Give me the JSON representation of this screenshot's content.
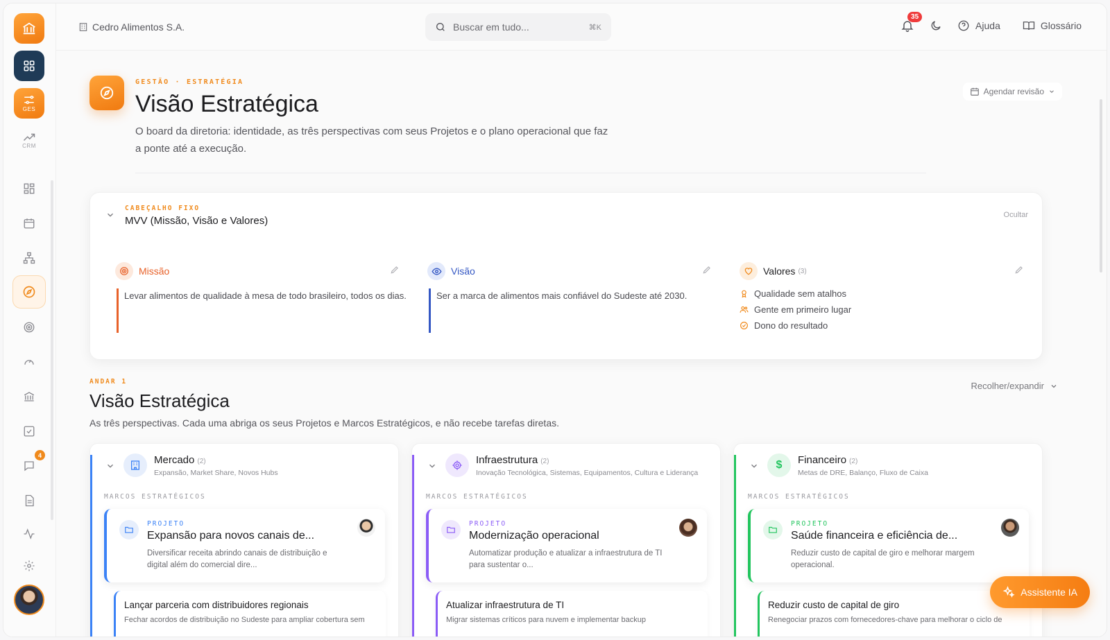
{
  "topbar": {
    "company": "Cedro Alimentos S.A.",
    "search_placeholder": "Buscar em tudo...",
    "search_shortcut": "⌘K",
    "notifications_count": "35",
    "help_label": "Ajuda",
    "glossary_label": "Glossário"
  },
  "sidebar": {
    "ges_label": "GES",
    "crm_label": "CRM",
    "messages_badge": "4"
  },
  "page": {
    "breadcrumb": "GESTÃO · ESTRATÉGIA",
    "title": "Visão Estratégica",
    "description": "O board da diretoria: identidade, as três perspectivas com seus Projetos e o plano operacional que faz a ponte até a execução.",
    "schedule_label": "Agendar revisão"
  },
  "mvv": {
    "label": "CABEÇALHO FIXO",
    "title": "MVV (Missão, Visão e Valores)",
    "hide_label": "Ocultar",
    "missao": {
      "title": "Missão",
      "text": "Levar alimentos de qualidade à mesa de todo brasileiro, todos os dias."
    },
    "visao": {
      "title": "Visão",
      "text": "Ser a marca de alimentos mais confiável do Sudeste até 2030."
    },
    "valores": {
      "title": "Valores",
      "count": "(3)",
      "items": [
        "Qualidade sem atalhos",
        "Gente em primeiro lugar",
        "Dono do resultado"
      ]
    }
  },
  "section": {
    "label": "ANDAR 1",
    "title": "Visão Estratégica",
    "description": "As três perspectivas. Cada uma abriga os seus Projetos e Marcos Estratégicos, e não recebe tarefas diretas.",
    "collapse_label": "Recolher/expandir"
  },
  "perspectives": [
    {
      "title": "Mercado",
      "count": "(2)",
      "subtitle": "Expansão, Market Share, Novos Hubs",
      "marcos_label": "MARCOS ESTRATÉGICOS",
      "project_label": "PROJETO",
      "project_title": "Expansão para novos canais de...",
      "project_desc": "Diversificar receita abrindo canais de distribuição e digital além do comercial dire...",
      "marco_title": "Lançar parceria com distribuidores regionais",
      "marco_desc": "Fechar acordos de distribuição no Sudeste para ampliar cobertura sem"
    },
    {
      "title": "Infraestrutura",
      "count": "(2)",
      "subtitle": "Inovação Tecnológica, Sistemas, Equipamentos, Cultura e Liderança",
      "marcos_label": "MARCOS ESTRATÉGICOS",
      "project_label": "PROJETO",
      "project_title": "Modernização operacional",
      "project_desc": "Automatizar produção e atualizar a infraestrutura de TI para sustentar o...",
      "marco_title": "Atualizar infraestrutura de TI",
      "marco_desc": "Migrar sistemas críticos para nuvem e implementar backup"
    },
    {
      "title": "Financeiro",
      "count": "(2)",
      "subtitle": "Metas de DRE, Balanço, Fluxo de Caixa",
      "marcos_label": "MARCOS ESTRATÉGICOS",
      "project_label": "PROJETO",
      "project_title": "Saúde financeira e eficiência de...",
      "project_desc": "Reduzir custo de capital de giro e melhorar margem operacional.",
      "marco_title": "Reduzir custo de capital de giro",
      "marco_desc": "Renegociar prazos com fornecedores-chave para melhorar o ciclo de"
    }
  ],
  "assistant_label": "Assistente IA",
  "colors": {
    "accent": "#f08a1c",
    "mercado": "#3b82f6",
    "infraestrutura": "#8b5cf6",
    "financeiro": "#22c55e"
  }
}
